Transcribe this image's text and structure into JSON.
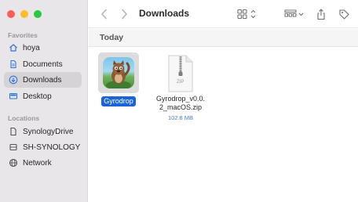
{
  "window": {
    "title": "Downloads"
  },
  "sidebar": {
    "favorites_label": "Favorites",
    "locations_label": "Locations",
    "favorites": [
      {
        "label": "hoya",
        "icon": "home-icon"
      },
      {
        "label": "Documents",
        "icon": "document-icon"
      },
      {
        "label": "Downloads",
        "icon": "download-icon",
        "selected": true
      },
      {
        "label": "Desktop",
        "icon": "desktop-icon"
      }
    ],
    "locations": [
      {
        "label": "SynologyDrive",
        "icon": "drive-icon"
      },
      {
        "label": "SH-SYNOLOGY",
        "icon": "server-icon"
      },
      {
        "label": "Network",
        "icon": "network-icon"
      }
    ]
  },
  "content": {
    "group_title": "Today",
    "files": [
      {
        "name": "Gyrodrop",
        "icon": "app-icon",
        "selected": true
      },
      {
        "name_line1": "Gyrodrop_v0.0.",
        "name_line2": "2_macOS.zip",
        "size": "102.8 MB",
        "icon": "zip-file-icon",
        "badge": "ZIP"
      }
    ]
  },
  "colors": {
    "sidebar_bg": "#e9e6ea",
    "selection_blue": "#1b64d8",
    "size_text": "#4a7fd0"
  }
}
